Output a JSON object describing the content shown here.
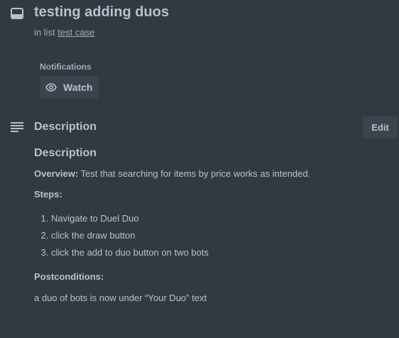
{
  "card": {
    "title": "testing adding duos",
    "in_list_prefix": "in list",
    "list_name": "test case",
    "icon": "card-icon"
  },
  "notifications": {
    "label": "Notifications",
    "watch_label": "Watch",
    "watch_icon": "eye-icon"
  },
  "description_section": {
    "heading": "Description",
    "edit_label": "Edit",
    "icon": "description-lines-icon"
  },
  "description": {
    "title": "Description",
    "overview_label": "Overview:",
    "overview_text": " Test that searching for items by price works as intended.",
    "steps_label": "Steps:",
    "steps": [
      "Navigate to Duel Duo",
      "click the draw button",
      "click the add to duo button on two bots"
    ],
    "postconditions_label": "Postconditions:",
    "postconditions_text": "a duo of bots is now under “Your Duo” text"
  },
  "colors": {
    "background": "#323940",
    "text": "#b6c2cf",
    "subtle_text": "#9fadbc",
    "button_bg": "#3b444d"
  }
}
